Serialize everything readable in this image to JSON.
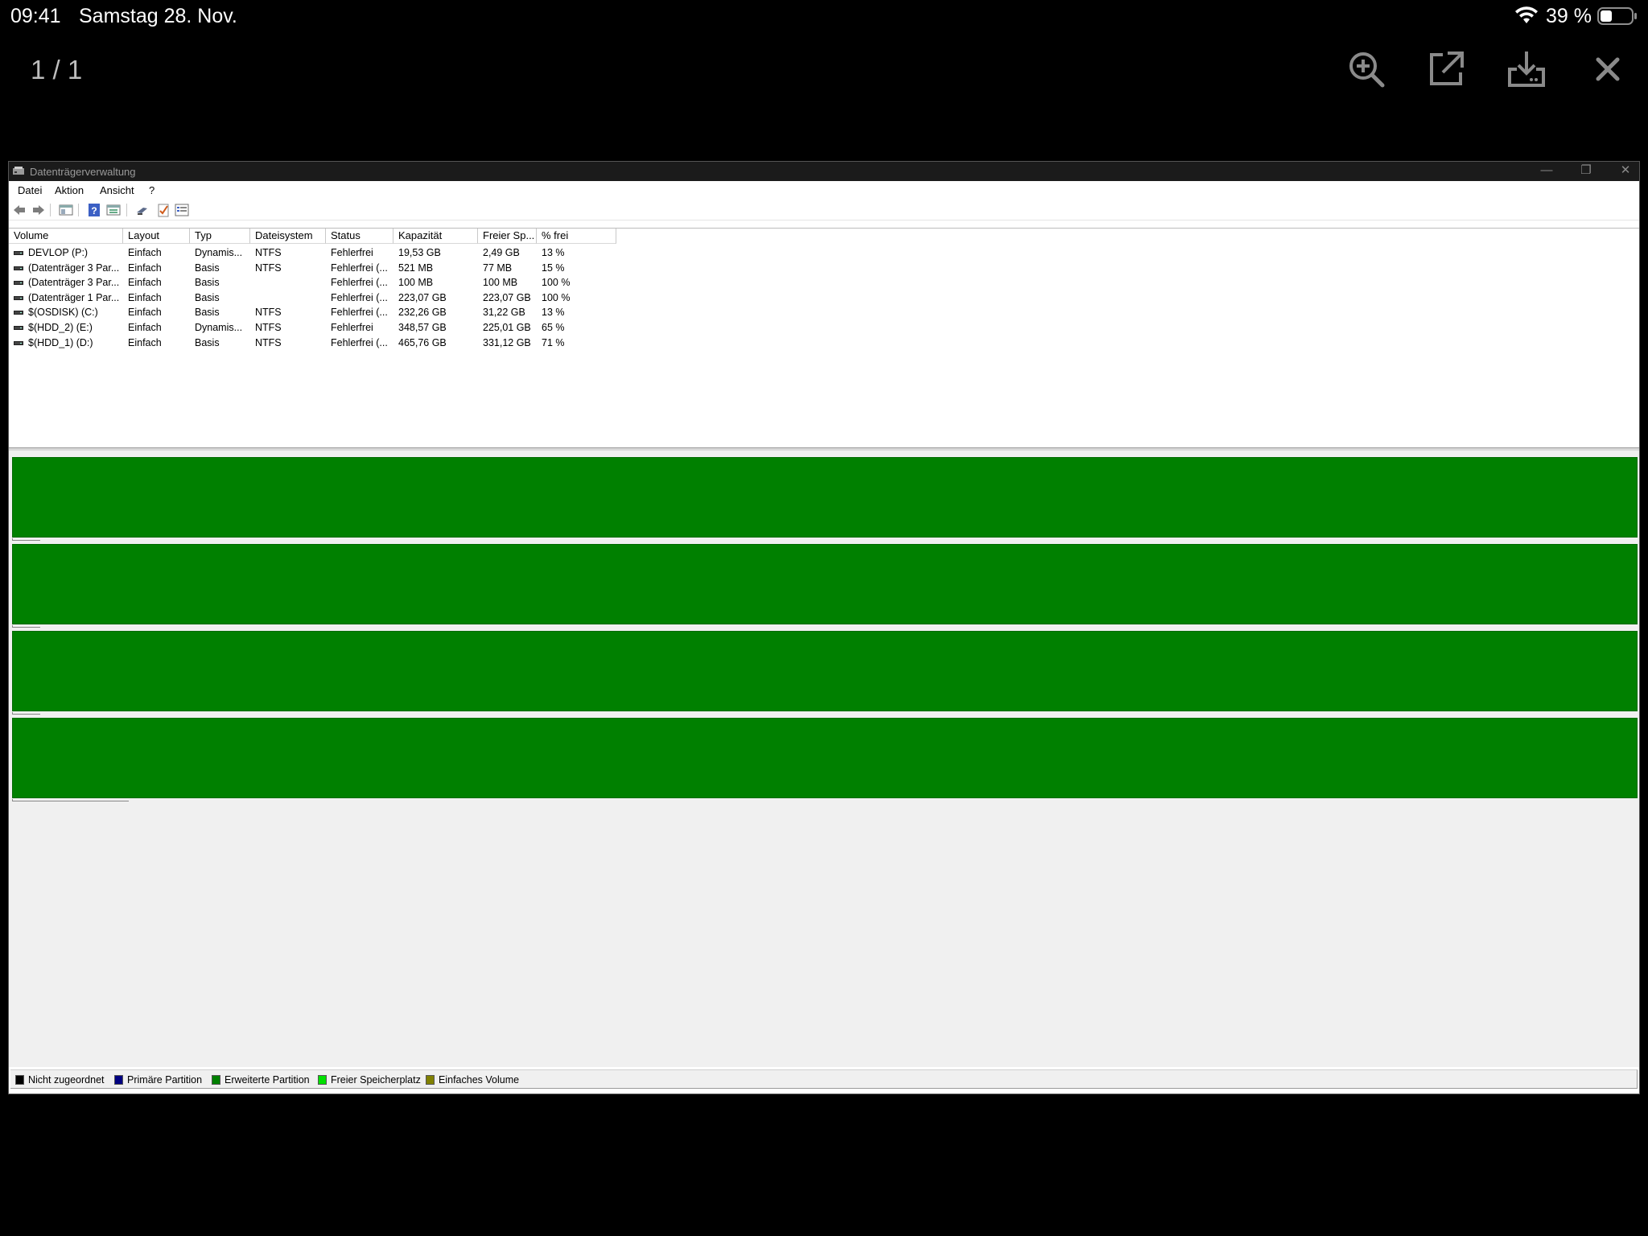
{
  "status_bar": {
    "time": "09:41",
    "date": "Samstag 28. Nov.",
    "battery_percent": "39 %",
    "battery_level": 0.39
  },
  "viewer": {
    "page_counter": "1 / 1",
    "buttons": [
      "zoom-in-icon",
      "open-external-icon",
      "download-icon",
      "close-icon"
    ]
  },
  "window": {
    "title": "Datenträgerverwaltung",
    "menu": [
      "Datei",
      "Aktion",
      "Ansicht",
      "?"
    ]
  },
  "table": {
    "columns": [
      "Volume",
      "Layout",
      "Typ",
      "Dateisystem",
      "Status",
      "Kapazität",
      "Freier Sp...",
      "% frei"
    ],
    "rows": [
      [
        "DEVLOP (P:)",
        "Einfach",
        "Dynamis...",
        "NTFS",
        "Fehlerfrei",
        "19,53 GB",
        "2,49 GB",
        "13 %"
      ],
      [
        "(Datenträger 3 Par...",
        "Einfach",
        "Basis",
        "NTFS",
        "Fehlerfrei (...",
        "521 MB",
        "77 MB",
        "15 %"
      ],
      [
        "(Datenträger 3 Par...",
        "Einfach",
        "Basis",
        "",
        "Fehlerfrei (...",
        "100 MB",
        "100 MB",
        "100 %"
      ],
      [
        "(Datenträger 1 Par...",
        "Einfach",
        "Basis",
        "",
        "Fehlerfrei (...",
        "223,07 GB",
        "223,07 GB",
        "100 %"
      ],
      [
        "$(OSDISK) (C:)",
        "Einfach",
        "Basis",
        "NTFS",
        "Fehlerfrei (...",
        "232,26 GB",
        "31,22 GB",
        "13 %"
      ],
      [
        "$(HDD_2) (E:)",
        "Einfach",
        "Dynamis...",
        "NTFS",
        "Fehlerfrei",
        "348,57 GB",
        "225,01 GB",
        "65 %"
      ],
      [
        "$(HDD_1) (D:)",
        "Einfach",
        "Basis",
        "NTFS",
        "Fehlerfrei (...",
        "465,76 GB",
        "331,12 GB",
        "71 %"
      ]
    ]
  },
  "disk_blocks_count": 4,
  "legend": [
    {
      "label": "Nicht zugeordnet",
      "color": "#000000"
    },
    {
      "label": "Primäre Partition",
      "color": "#000080"
    },
    {
      "label": "Erweiterte Partition",
      "color": "#008000"
    },
    {
      "label": "Freier Speicherplatz",
      "color": "#00e000"
    },
    {
      "label": "Einfaches Volume",
      "color": "#808000"
    }
  ],
  "colors": {
    "disk_block": "#008000"
  }
}
